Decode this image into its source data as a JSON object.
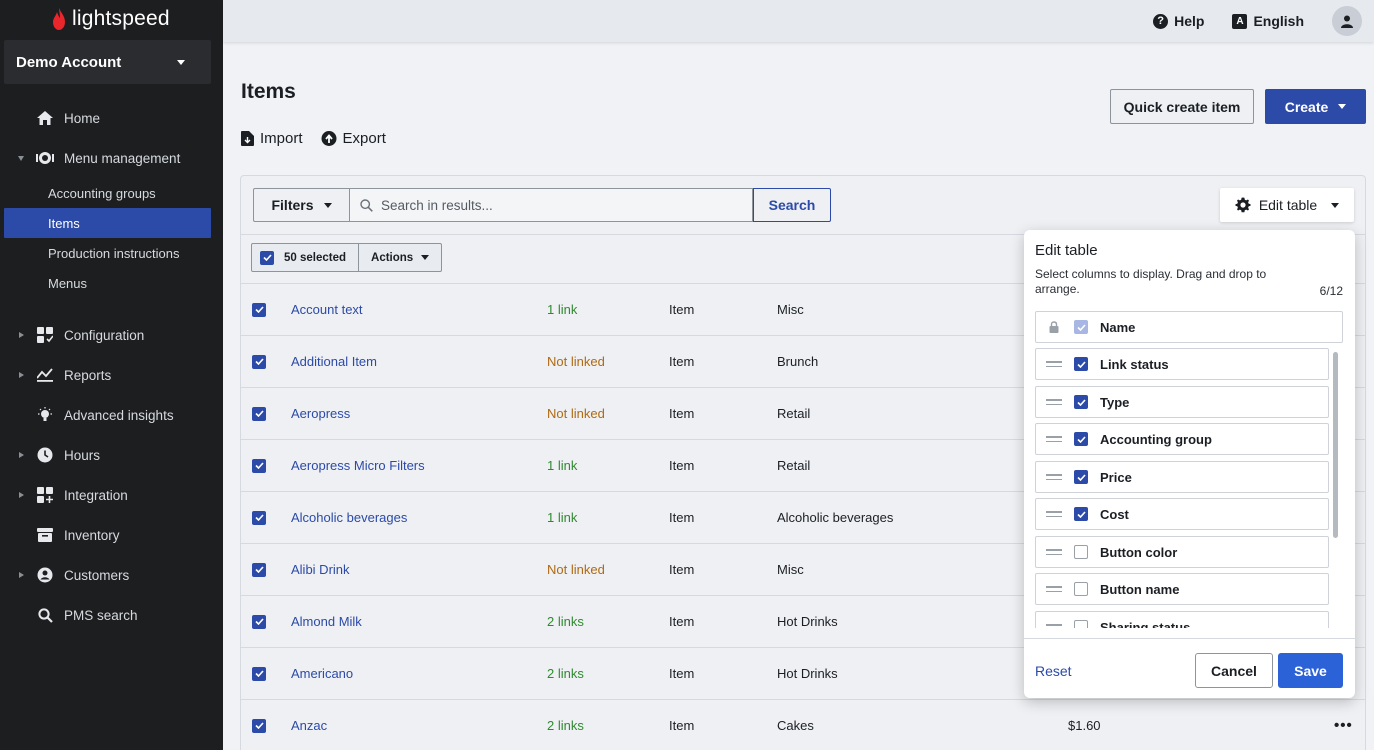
{
  "app": {
    "brand": "lightspeed"
  },
  "sidebar": {
    "account": "Demo Account",
    "items": [
      {
        "label": "Home",
        "icon": "home-icon"
      },
      {
        "label": "Menu management",
        "icon": "menu-management-icon",
        "expanded": true,
        "children": [
          "Accounting groups",
          "Items",
          "Production instructions",
          "Menus"
        ]
      },
      {
        "label": "Configuration",
        "icon": "configuration-icon"
      },
      {
        "label": "Reports",
        "icon": "reports-icon"
      },
      {
        "label": "Advanced insights",
        "icon": "insights-icon"
      },
      {
        "label": "Hours",
        "icon": "clock-icon"
      },
      {
        "label": "Integration",
        "icon": "integration-icon"
      },
      {
        "label": "Inventory",
        "icon": "inventory-icon"
      },
      {
        "label": "Customers",
        "icon": "customers-icon"
      },
      {
        "label": "PMS search",
        "icon": "search-icon"
      }
    ],
    "active_child": "Items"
  },
  "topbar": {
    "help": "Help",
    "language": "English"
  },
  "page": {
    "title": "Items",
    "import": "Import",
    "export": "Export",
    "quick_create": "Quick create item",
    "create": "Create"
  },
  "toolbar": {
    "filters": "Filters",
    "search_placeholder": "Search in results...",
    "search_button": "Search",
    "edit_table": "Edit table",
    "selected": "50 selected",
    "actions": "Actions"
  },
  "table": {
    "rows": [
      {
        "name": "Account text",
        "link": "1 link",
        "linked": true,
        "type": "Item",
        "group": "Misc",
        "price": ""
      },
      {
        "name": "Additional Item",
        "link": "Not linked",
        "linked": false,
        "type": "Item",
        "group": "Brunch",
        "price": ""
      },
      {
        "name": "Aeropress",
        "link": "Not linked",
        "linked": false,
        "type": "Item",
        "group": "Retail",
        "price": ""
      },
      {
        "name": "Aeropress Micro Filters",
        "link": "1 link",
        "linked": true,
        "type": "Item",
        "group": "Retail",
        "price": ""
      },
      {
        "name": "Alcoholic beverages",
        "link": "1 link",
        "linked": true,
        "type": "Item",
        "group": "Alcoholic beverages",
        "price": ""
      },
      {
        "name": "Alibi Drink",
        "link": "Not linked",
        "linked": false,
        "type": "Item",
        "group": "Misc",
        "price": ""
      },
      {
        "name": "Almond Milk",
        "link": "2 links",
        "linked": true,
        "type": "Item",
        "group": "Hot Drinks",
        "price": ""
      },
      {
        "name": "Americano",
        "link": "2 links",
        "linked": true,
        "type": "Item",
        "group": "Hot Drinks",
        "price": ""
      },
      {
        "name": "Anzac",
        "link": "2 links",
        "linked": true,
        "type": "Item",
        "group": "Cakes",
        "price": "$1.60"
      }
    ]
  },
  "edit_table": {
    "title": "Edit table",
    "description": "Select columns to display. Drag and drop to arrange.",
    "count": "6/12",
    "columns": [
      {
        "label": "Name",
        "checked": true,
        "locked": true
      },
      {
        "label": "Link status",
        "checked": true
      },
      {
        "label": "Type",
        "checked": true
      },
      {
        "label": "Accounting group",
        "checked": true
      },
      {
        "label": "Price",
        "checked": true
      },
      {
        "label": "Cost",
        "checked": true
      },
      {
        "label": "Button color",
        "checked": false
      },
      {
        "label": "Button name",
        "checked": false
      },
      {
        "label": "Sharing status",
        "checked": false
      }
    ],
    "reset": "Reset",
    "cancel": "Cancel",
    "save": "Save"
  }
}
